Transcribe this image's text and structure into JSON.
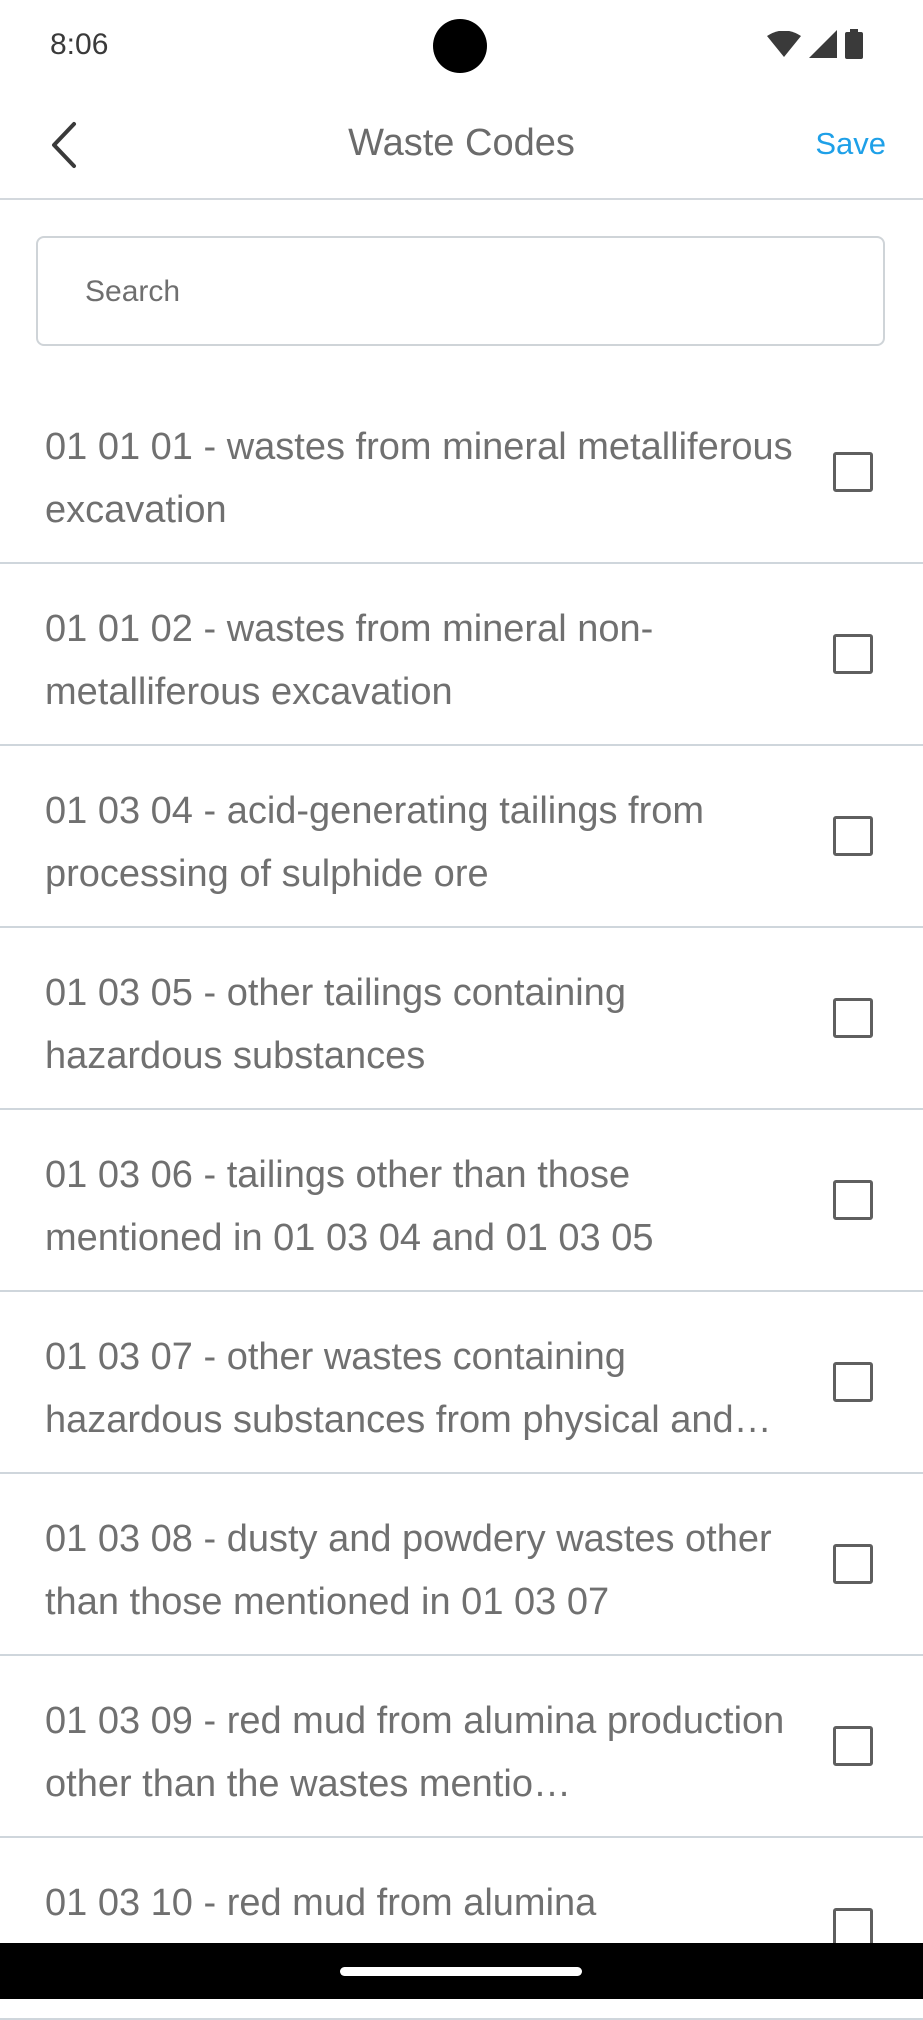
{
  "status_bar": {
    "time": "8:06",
    "icons": [
      "wifi-icon",
      "signal-icon",
      "battery-icon"
    ]
  },
  "header": {
    "back_icon": "chevron-left-icon",
    "title": "Waste Codes",
    "save_label": "Save"
  },
  "search": {
    "placeholder": "Search",
    "value": ""
  },
  "items": [
    {
      "label": "01 01 01 - wastes from mineral metalliferous excavation",
      "checked": false
    },
    {
      "label": "01 01 02 - wastes from mineral non-metalliferous excavation",
      "checked": false
    },
    {
      "label": "01 03 04 - acid-generating tailings from processing of sulphide ore",
      "checked": false
    },
    {
      "label": "01 03 05 - other tailings containing hazardous substances",
      "checked": false
    },
    {
      "label": "01 03 06 - tailings other than those mentioned in 01 03 04 and 01 03 05",
      "checked": false
    },
    {
      "label": "01 03 07 - other wastes containing hazardous substances from physical and…",
      "checked": false
    },
    {
      "label": "01 03 08 - dusty and powdery wastes other than those mentioned in 01 03 07",
      "checked": false
    },
    {
      "label": "01 03 09 - red mud from alumina production other than the wastes mentio…",
      "checked": false
    },
    {
      "label": "01 03 10 - red mud from alumina",
      "checked": false
    }
  ],
  "colors": {
    "accent": "#1ea0e8",
    "text": "#707070",
    "divider": "#cfd6dc"
  }
}
